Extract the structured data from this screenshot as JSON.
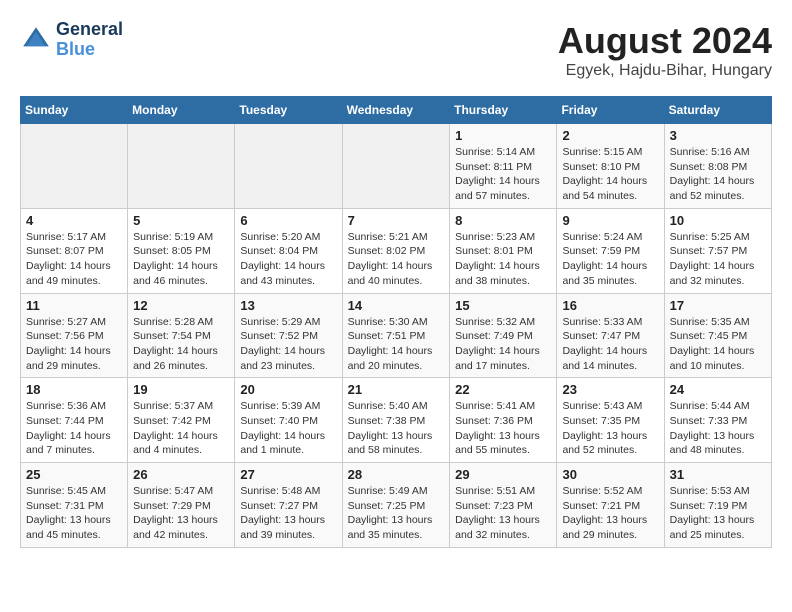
{
  "header": {
    "logo_line1": "General",
    "logo_line2": "Blue",
    "main_title": "August 2024",
    "subtitle": "Egyek, Hajdu-Bihar, Hungary"
  },
  "weekdays": [
    "Sunday",
    "Monday",
    "Tuesday",
    "Wednesday",
    "Thursday",
    "Friday",
    "Saturday"
  ],
  "weeks": [
    [
      {
        "day": "",
        "info": ""
      },
      {
        "day": "",
        "info": ""
      },
      {
        "day": "",
        "info": ""
      },
      {
        "day": "",
        "info": ""
      },
      {
        "day": "1",
        "info": "Sunrise: 5:14 AM\nSunset: 8:11 PM\nDaylight: 14 hours\nand 57 minutes."
      },
      {
        "day": "2",
        "info": "Sunrise: 5:15 AM\nSunset: 8:10 PM\nDaylight: 14 hours\nand 54 minutes."
      },
      {
        "day": "3",
        "info": "Sunrise: 5:16 AM\nSunset: 8:08 PM\nDaylight: 14 hours\nand 52 minutes."
      }
    ],
    [
      {
        "day": "4",
        "info": "Sunrise: 5:17 AM\nSunset: 8:07 PM\nDaylight: 14 hours\nand 49 minutes."
      },
      {
        "day": "5",
        "info": "Sunrise: 5:19 AM\nSunset: 8:05 PM\nDaylight: 14 hours\nand 46 minutes."
      },
      {
        "day": "6",
        "info": "Sunrise: 5:20 AM\nSunset: 8:04 PM\nDaylight: 14 hours\nand 43 minutes."
      },
      {
        "day": "7",
        "info": "Sunrise: 5:21 AM\nSunset: 8:02 PM\nDaylight: 14 hours\nand 40 minutes."
      },
      {
        "day": "8",
        "info": "Sunrise: 5:23 AM\nSunset: 8:01 PM\nDaylight: 14 hours\nand 38 minutes."
      },
      {
        "day": "9",
        "info": "Sunrise: 5:24 AM\nSunset: 7:59 PM\nDaylight: 14 hours\nand 35 minutes."
      },
      {
        "day": "10",
        "info": "Sunrise: 5:25 AM\nSunset: 7:57 PM\nDaylight: 14 hours\nand 32 minutes."
      }
    ],
    [
      {
        "day": "11",
        "info": "Sunrise: 5:27 AM\nSunset: 7:56 PM\nDaylight: 14 hours\nand 29 minutes."
      },
      {
        "day": "12",
        "info": "Sunrise: 5:28 AM\nSunset: 7:54 PM\nDaylight: 14 hours\nand 26 minutes."
      },
      {
        "day": "13",
        "info": "Sunrise: 5:29 AM\nSunset: 7:52 PM\nDaylight: 14 hours\nand 23 minutes."
      },
      {
        "day": "14",
        "info": "Sunrise: 5:30 AM\nSunset: 7:51 PM\nDaylight: 14 hours\nand 20 minutes."
      },
      {
        "day": "15",
        "info": "Sunrise: 5:32 AM\nSunset: 7:49 PM\nDaylight: 14 hours\nand 17 minutes."
      },
      {
        "day": "16",
        "info": "Sunrise: 5:33 AM\nSunset: 7:47 PM\nDaylight: 14 hours\nand 14 minutes."
      },
      {
        "day": "17",
        "info": "Sunrise: 5:35 AM\nSunset: 7:45 PM\nDaylight: 14 hours\nand 10 minutes."
      }
    ],
    [
      {
        "day": "18",
        "info": "Sunrise: 5:36 AM\nSunset: 7:44 PM\nDaylight: 14 hours\nand 7 minutes."
      },
      {
        "day": "19",
        "info": "Sunrise: 5:37 AM\nSunset: 7:42 PM\nDaylight: 14 hours\nand 4 minutes."
      },
      {
        "day": "20",
        "info": "Sunrise: 5:39 AM\nSunset: 7:40 PM\nDaylight: 14 hours\nand 1 minute."
      },
      {
        "day": "21",
        "info": "Sunrise: 5:40 AM\nSunset: 7:38 PM\nDaylight: 13 hours\nand 58 minutes."
      },
      {
        "day": "22",
        "info": "Sunrise: 5:41 AM\nSunset: 7:36 PM\nDaylight: 13 hours\nand 55 minutes."
      },
      {
        "day": "23",
        "info": "Sunrise: 5:43 AM\nSunset: 7:35 PM\nDaylight: 13 hours\nand 52 minutes."
      },
      {
        "day": "24",
        "info": "Sunrise: 5:44 AM\nSunset: 7:33 PM\nDaylight: 13 hours\nand 48 minutes."
      }
    ],
    [
      {
        "day": "25",
        "info": "Sunrise: 5:45 AM\nSunset: 7:31 PM\nDaylight: 13 hours\nand 45 minutes."
      },
      {
        "day": "26",
        "info": "Sunrise: 5:47 AM\nSunset: 7:29 PM\nDaylight: 13 hours\nand 42 minutes."
      },
      {
        "day": "27",
        "info": "Sunrise: 5:48 AM\nSunset: 7:27 PM\nDaylight: 13 hours\nand 39 minutes."
      },
      {
        "day": "28",
        "info": "Sunrise: 5:49 AM\nSunset: 7:25 PM\nDaylight: 13 hours\nand 35 minutes."
      },
      {
        "day": "29",
        "info": "Sunrise: 5:51 AM\nSunset: 7:23 PM\nDaylight: 13 hours\nand 32 minutes."
      },
      {
        "day": "30",
        "info": "Sunrise: 5:52 AM\nSunset: 7:21 PM\nDaylight: 13 hours\nand 29 minutes."
      },
      {
        "day": "31",
        "info": "Sunrise: 5:53 AM\nSunset: 7:19 PM\nDaylight: 13 hours\nand 25 minutes."
      }
    ]
  ]
}
